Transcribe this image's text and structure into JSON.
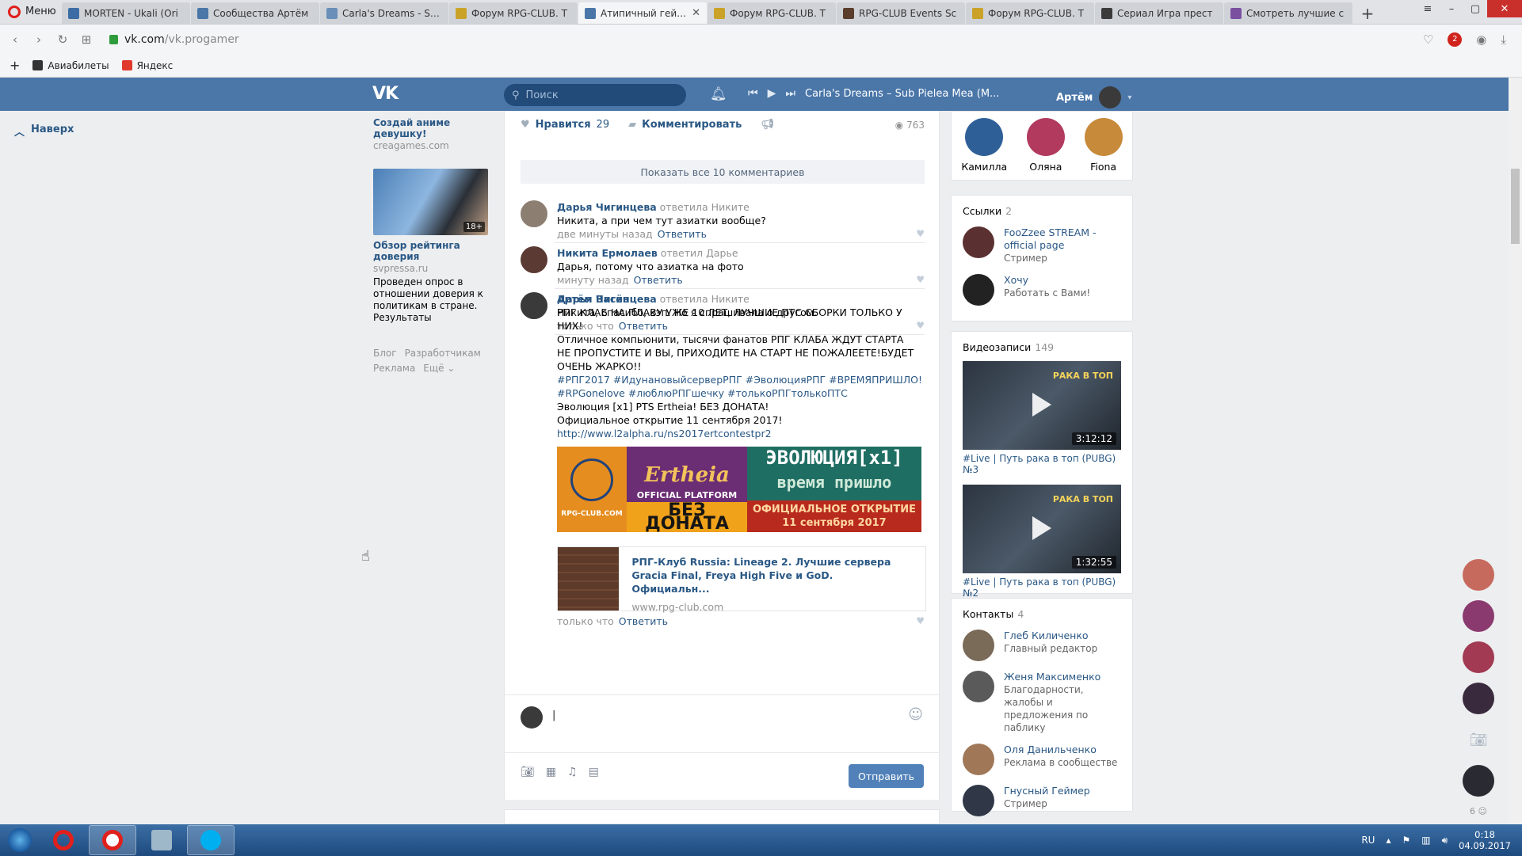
{
  "browser": {
    "menu_label": "Меню",
    "tabs": [
      {
        "title": "MORTEN - Ukali (Ori",
        "color": "#3c6ca3",
        "active": false
      },
      {
        "title": "Сообщества Артём",
        "color": "#4a76a8",
        "active": false
      },
      {
        "title": "Carla's Dreams - Sub",
        "color": "#6a8fb8",
        "active": false
      },
      {
        "title": "Форум RPG-CLUB. T",
        "color": "#c9a227",
        "active": false
      },
      {
        "title": "Атипичный геймер",
        "color": "#4a76a8",
        "active": true
      },
      {
        "title": "Форум RPG-CLUB. T",
        "color": "#c9a227",
        "active": false
      },
      {
        "title": "RPG-CLUB Events Sc",
        "color": "#5a3d2b",
        "active": false
      },
      {
        "title": "Форум RPG-CLUB. T",
        "color": "#c9a227",
        "active": false
      },
      {
        "title": "Сериал Игра прест",
        "color": "#3b3b3b",
        "active": false
      },
      {
        "title": "Смотреть лучшие с",
        "color": "#7a4fa0",
        "active": false
      }
    ],
    "url_host": "vk.com",
    "url_path": "/vk.progamer",
    "vpn_count": "2",
    "bookmarks": [
      {
        "label": "Авиабилеты",
        "color": "#333333"
      },
      {
        "label": "Яндекс",
        "color": "#e03a2f"
      }
    ]
  },
  "vk": {
    "logo": "VK",
    "search_placeholder": "Поиск",
    "track": "Carla's Dreams – Sub Pielea Mea (M...",
    "user_name": "Артём",
    "up_label": "Наверх"
  },
  "ads": {
    "ad1_title": "Создай аниме девушку!",
    "ad1_domain": "creagames.com",
    "ad2_badge": "18+",
    "ad2_title": "Обзор рейтинга доверия",
    "ad2_domain": "svpressa.ru",
    "ad2_desc": "Проведен опрос в отношении доверия к политикам в стране. Результаты",
    "footer": [
      "Блог",
      "Разработчикам",
      "Реклама",
      "Ещё ⌄"
    ]
  },
  "post": {
    "like_label": "Нравится",
    "like_count": "29",
    "comment_label": "Комментировать",
    "views": "763",
    "show_all": "Показать все 10 комментариев",
    "reply_label": "Ответить"
  },
  "comments": [
    {
      "author": "Дарья Чигинцева",
      "reply_to": "ответила Никите",
      "text": "Никита, а при чем тут азиатки вообще?",
      "time": "две минуты назад"
    },
    {
      "author": "Никита Ермолаев",
      "reply_to": "ответил Дарье",
      "text": "Дарья, потому что азиатка на фото",
      "time": "минуту назад"
    },
    {
      "author": "Дарья Чигинцева",
      "reply_to": "ответила Никите",
      "text": "Никита, спасибо, кэп. Но я спрашивала о другом.",
      "time": "только что"
    }
  ],
  "big_comment": {
    "author": "Артём Васёв",
    "lines": [
      "РПГ КЛАБ НА ПЛАВУ УЖЕ 10 ЛЕТ, ЛУЧШИЕ ПТС СБОРКИ ТОЛЬКО У НИХ!",
      "Отличное компьюнити, тысячи фанатов РПГ КЛАБА ЖДУТ СТАРТА",
      "НЕ ПРОПУСТИТЕ И ВЫ, ПРИХОДИТЕ НА СТАРТ НЕ ПОЖАЛЕЕТЕ!БУДЕТ ОЧЕНЬ ЖАРКО!!"
    ],
    "hashtags1": "#РПГ2017 #ИдунановыйсерверРПГ #ЭволюцияРПГ #ВРЕМЯПРИШЛО!",
    "hashtags2": "#RPGonelove #люблюРПГшечку #толькоРПГтолькоПТС",
    "line4": "Эволюция [x1] PTS Ertheia! БЕЗ ДОНАТА!",
    "line5": "Официальное открытие 11 сентября 2017!",
    "link": "http://www.l2alpha.ru/ns2017ertcontestpr2",
    "banner_site": "RPG-CLUB.COM",
    "banner_logo": "Ertheia",
    "banner_platform": "OFFICIAL PLATFORM",
    "banner_nodonate": "БЕЗ ДОНАТА",
    "banner_evo": "ЭВОЛЮЦИЯ[x1]",
    "banner_time": "время пришло",
    "banner_open": "ОФИЦИАЛЬНОЕ ОТКРЫТИЕ 11 сентября 2017",
    "card_title": "РПГ-Клуб Russia: Lineage 2. Лучшие сервера Gracia Final, Freya High Five и GoD. Официальн...",
    "card_domain": "www.rpg-club.com",
    "time": "только что"
  },
  "composer": {
    "caret": "|",
    "send_label": "Отправить"
  },
  "right": {
    "friends": [
      {
        "name": "Камилла",
        "color": "#2f5f97"
      },
      {
        "name": "Оляна",
        "color": "#b13a5e"
      },
      {
        "name": "Fiona",
        "color": "#c78a3a"
      }
    ],
    "links_title": "Ссылки",
    "links_count": "2",
    "links": [
      {
        "name": "FooZzee STREAM - official page",
        "sub": "Стример",
        "color": "#5a3030"
      },
      {
        "name": "Хочу",
        "sub": "Работать с Вами!",
        "color": "#222222"
      }
    ],
    "videos_title": "Видеозаписи",
    "videos_count": "149",
    "videos": [
      {
        "duration": "3:12:12",
        "tag": "РАКА В ТОП",
        "caption": "#Live | Путь рака в топ (PUBG) №3"
      },
      {
        "duration": "1:32:55",
        "tag": "РАКА В ТОП",
        "caption": "#Live | Путь рака в топ (PUBG) №2"
      }
    ],
    "contacts_title": "Контакты",
    "contacts_count": "4",
    "contacts": [
      {
        "name": "Глеб Киличенко",
        "sub": "Главный редактор",
        "color": "#7a6a58"
      },
      {
        "name": "Женя Максименко",
        "sub": "Благодарности, жалобы и предложения по паблику",
        "color": "#5a5a5a"
      },
      {
        "name": "Оля Данильченко",
        "sub": "Реклама в сообществе",
        "color": "#a07858"
      },
      {
        "name": "Гнусный Геймер",
        "sub": "Стример",
        "color": "#303848"
      }
    ]
  },
  "fastchat_count": "6",
  "taskbar": {
    "lang": "RU",
    "time": "0:18",
    "date": "04.09.2017"
  }
}
